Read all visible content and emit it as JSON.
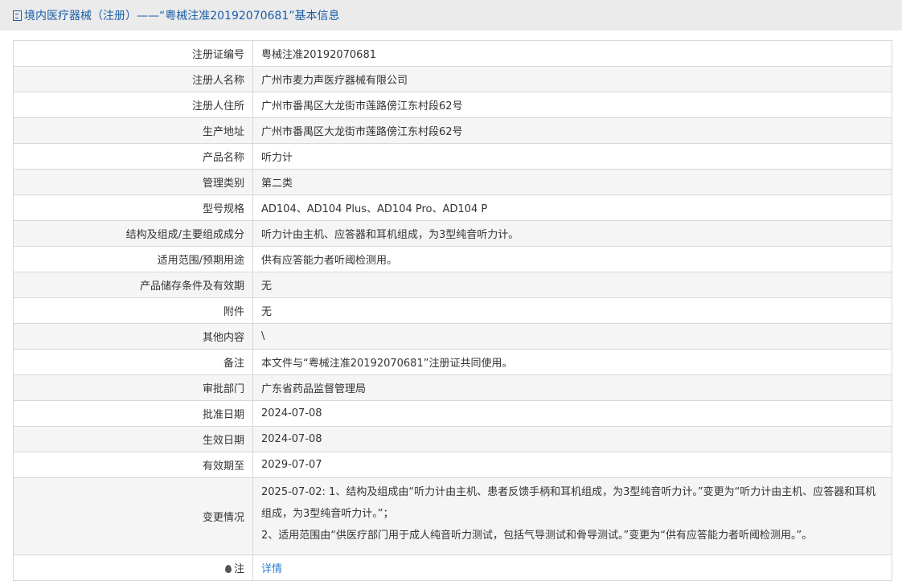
{
  "header": {
    "title": "境内医疗器械（注册）——“粤械注准20192070681”基本信息"
  },
  "rows": [
    {
      "label": "注册证编号",
      "value": "粤械注准20192070681"
    },
    {
      "label": "注册人名称",
      "value": "广州市麦力声医疗器械有限公司"
    },
    {
      "label": "注册人住所",
      "value": "广州市番禺区大龙街市莲路傍江东村段62号"
    },
    {
      "label": "生产地址",
      "value": "广州市番禺区大龙街市莲路傍江东村段62号"
    },
    {
      "label": "产品名称",
      "value": "听力计"
    },
    {
      "label": "管理类别",
      "value": "第二类"
    },
    {
      "label": "型号规格",
      "value": "AD104、AD104 Plus、AD104 Pro、AD104 P"
    },
    {
      "label": "结构及组成/主要组成成分",
      "value": "听力计由主机、应答器和耳机组成，为3型纯音听力计。"
    },
    {
      "label": "适用范围/预期用途",
      "value": "供有应答能力者听阈检测用。"
    },
    {
      "label": "产品储存条件及有效期",
      "value": "无"
    },
    {
      "label": "附件",
      "value": "无"
    },
    {
      "label": "其他内容",
      "value": "\\"
    },
    {
      "label": "备注",
      "value": "本文件与“粤械注准20192070681”注册证共同使用。"
    },
    {
      "label": "审批部门",
      "value": "广东省药品监督管理局"
    },
    {
      "label": "批准日期",
      "value": "2024-07-08"
    },
    {
      "label": "生效日期",
      "value": "2024-07-08"
    },
    {
      "label": "有效期至",
      "value": "2029-07-07"
    }
  ],
  "changes": {
    "label": "变更情况",
    "line1": "2025-07-02: 1、结构及组成由“听力计由主机、患者反馈手柄和耳机组成，为3型纯音听力计。”变更为“听力计由主机、应答器和耳机组成，为3型纯音听力计。”；",
    "line2": "2、适用范围由“供医疗部门用于成人纯音听力测试，包括气导测试和骨导测试。”变更为“供有应答能力者听阈检测用。”。"
  },
  "note": {
    "label": "注",
    "link": "详情"
  }
}
